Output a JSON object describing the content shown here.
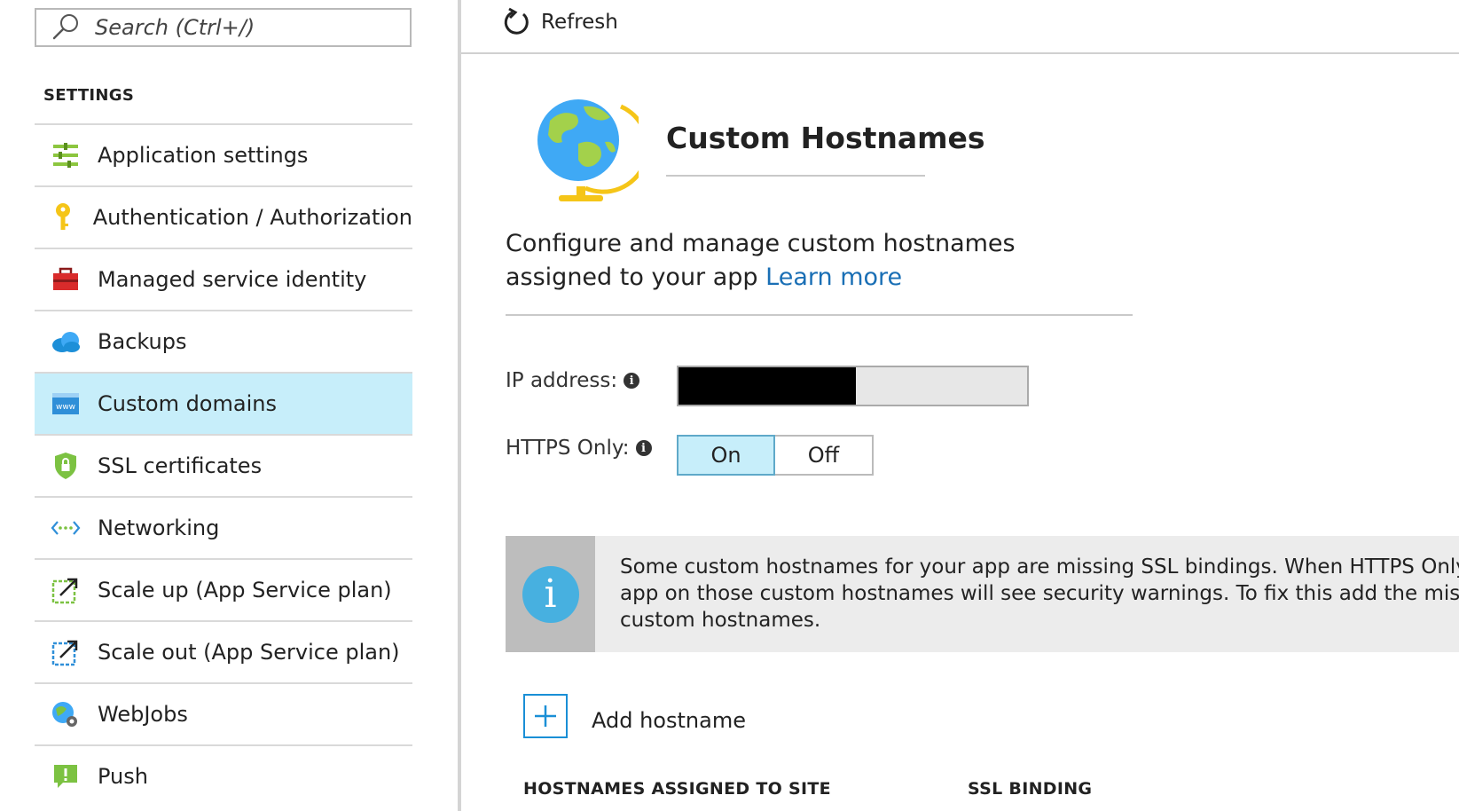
{
  "sidebar": {
    "search": {
      "placeholder": "Search (Ctrl+/)",
      "icon": "search-icon"
    },
    "section_title": "SETTINGS",
    "items": [
      {
        "label": "Application settings",
        "icon": "app-settings-icon"
      },
      {
        "label": "Authentication / Authorization",
        "icon": "key-icon"
      },
      {
        "label": "Managed service identity",
        "icon": "toolbox-icon"
      },
      {
        "label": "Backups",
        "icon": "cloud-backup-icon"
      },
      {
        "label": "Custom domains",
        "icon": "www-icon",
        "selected": true
      },
      {
        "label": "SSL certificates",
        "icon": "shield-lock-icon"
      },
      {
        "label": "Networking",
        "icon": "networking-icon"
      },
      {
        "label": "Scale up (App Service plan)",
        "icon": "scale-up-icon"
      },
      {
        "label": "Scale out (App Service plan)",
        "icon": "scale-out-icon"
      },
      {
        "label": "WebJobs",
        "icon": "webjobs-icon"
      },
      {
        "label": "Push",
        "icon": "push-icon"
      }
    ]
  },
  "toolbar": {
    "refresh_label": "Refresh",
    "refresh_icon": "refresh-icon"
  },
  "main": {
    "hero_icon": "globe-icon",
    "title": "Custom Hostnames",
    "description": "Configure and manage custom hostnames assigned to your app",
    "learn_more": "Learn more",
    "ip_label": "IP address:",
    "https_label": "HTTPS Only:",
    "https_options": [
      "On",
      "Off"
    ],
    "https_selected": "On",
    "banner": {
      "icon": "info-icon",
      "lines": [
        "Some custom hostnames for your app are missing SSL bindings. When HTTPS Only is ena",
        "app on those custom hostnames will see security warnings. To fix this add the missing SS",
        "custom hostnames."
      ]
    },
    "add_hostname_label": "Add hostname",
    "table_headers": [
      "HOSTNAMES ASSIGNED TO SITE",
      "SSL BINDING"
    ]
  },
  "colors": {
    "selected_bg": "#c7eefa",
    "link": "#1a6fb5",
    "accent_blue": "#1a8fd6",
    "info_blue": "#47b0e0"
  }
}
